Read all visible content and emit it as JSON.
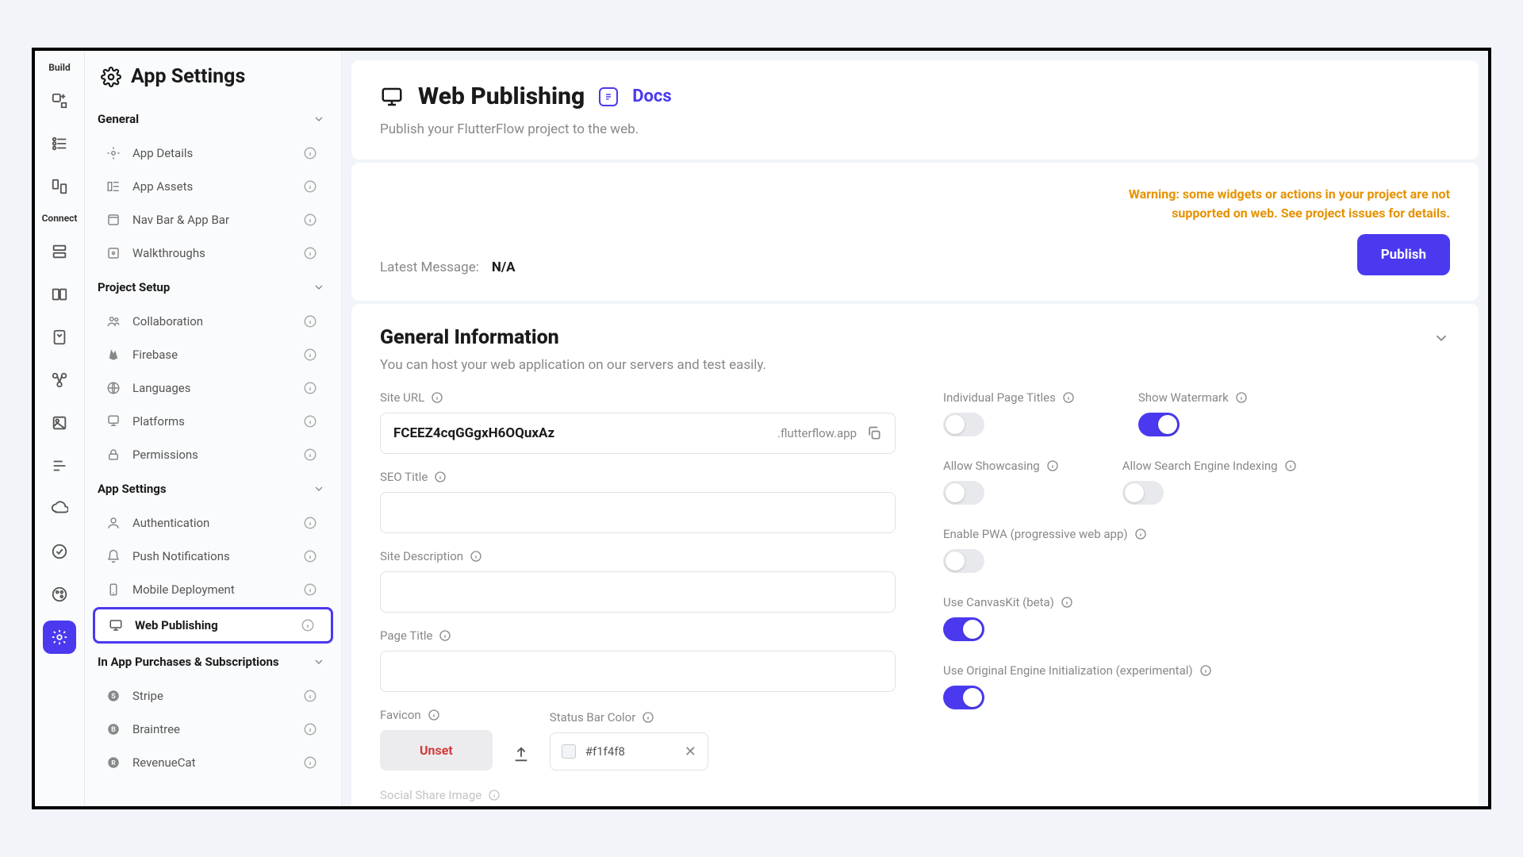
{
  "iconbar": {
    "section_build": "Build",
    "section_connect": "Connect"
  },
  "sidebar": {
    "title": "App Settings",
    "groups": [
      {
        "label": "General",
        "items": [
          {
            "label": "App Details"
          },
          {
            "label": "App Assets"
          },
          {
            "label": "Nav Bar & App Bar"
          },
          {
            "label": "Walkthroughs"
          }
        ]
      },
      {
        "label": "Project Setup",
        "items": [
          {
            "label": "Collaboration"
          },
          {
            "label": "Firebase"
          },
          {
            "label": "Languages"
          },
          {
            "label": "Platforms"
          },
          {
            "label": "Permissions"
          }
        ]
      },
      {
        "label": "App Settings",
        "items": [
          {
            "label": "Authentication"
          },
          {
            "label": "Push Notifications"
          },
          {
            "label": "Mobile Deployment"
          },
          {
            "label": "Web Publishing"
          }
        ]
      },
      {
        "label": "In App Purchases & Subscriptions",
        "items": [
          {
            "label": "Stripe"
          },
          {
            "label": "Braintree"
          },
          {
            "label": "RevenueCat"
          }
        ]
      }
    ]
  },
  "header": {
    "title": "Web Publishing",
    "docs": "Docs",
    "subtitle": "Publish your FlutterFlow project to the web."
  },
  "status": {
    "latest_label": "Latest Message:",
    "latest_value": "N/A",
    "warning": "Warning: some widgets or actions in your project are not supported on web. See project issues for details.",
    "publish": "Publish"
  },
  "general_info": {
    "title": "General Information",
    "subtitle": "You can host your web application on our servers and test easily.",
    "site_url": {
      "label": "Site URL",
      "value": "FCEEZ4cqGGgxH6OQuxAz",
      "suffix": ".flutterflow.app"
    },
    "seo_title": {
      "label": "SEO Title",
      "value": ""
    },
    "site_desc": {
      "label": "Site Description",
      "value": ""
    },
    "page_title": {
      "label": "Page Title",
      "value": ""
    },
    "favicon": {
      "label": "Favicon",
      "unset": "Unset"
    },
    "status_bar": {
      "label": "Status Bar Color",
      "value": "#f1f4f8"
    },
    "social_share": "Social Share Image",
    "toggles": {
      "individual_page_titles": {
        "label": "Individual Page Titles",
        "on": false
      },
      "show_watermark": {
        "label": "Show Watermark",
        "on": true
      },
      "allow_showcasing": {
        "label": "Allow Showcasing",
        "on": false
      },
      "allow_search_indexing": {
        "label": "Allow Search Engine Indexing",
        "on": false
      },
      "enable_pwa": {
        "label": "Enable PWA (progressive web app)",
        "on": false
      },
      "use_canvaskit": {
        "label": "Use CanvasKit (beta)",
        "on": true
      },
      "use_original_engine": {
        "label": "Use Original Engine Initialization (experimental)",
        "on": true
      }
    }
  }
}
